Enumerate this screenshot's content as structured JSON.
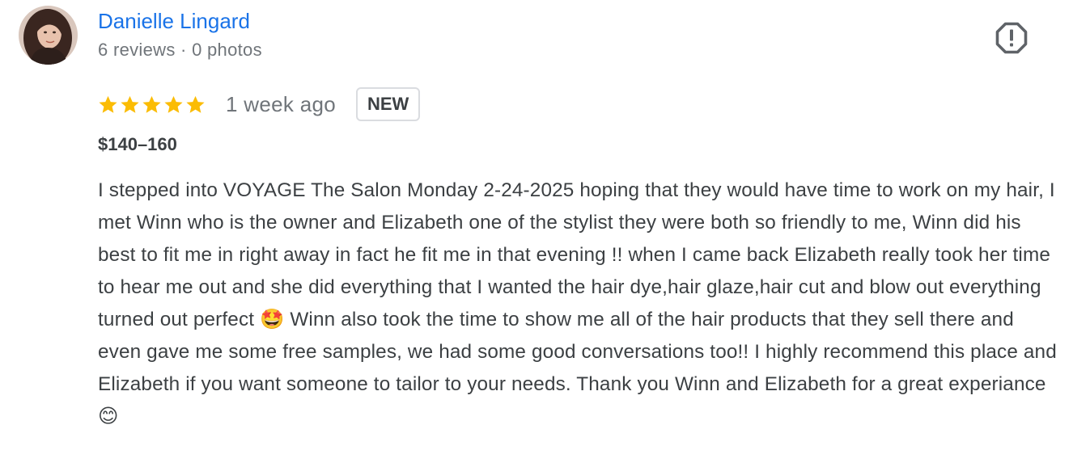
{
  "reviewer": {
    "name": "Danielle Lingard",
    "meta": "6 reviews · 0 photos",
    "avatar_icon": "reviewer-avatar-photo"
  },
  "report_icon": "report-flag-icon",
  "review": {
    "rating": 5,
    "rating_max": 5,
    "star_color": "#fbbc04",
    "time_ago": "1 week ago",
    "badge": "NEW",
    "price": "$140–160",
    "text": "I stepped into VOYAGE The Salon Monday 2-24-2025 hoping that they would have time to work on my hair, I met Winn who is the owner and Elizabeth one of the stylist they were both so friendly to me, Winn did his best to fit me in right away in fact he fit me in that evening !! when I came back Elizabeth really took her time to hear me out and she did everything that I wanted the hair dye,hair glaze,hair cut and blow out everything turned out perfect 🤩 Winn also took the time to show me all of the hair products that they sell there and even gave me some free samples, we had some good conversations too!! I highly recommend this place and Elizabeth if you want someone to tailor to your needs. Thank you Winn and Elizabeth for a great experiance😊"
  },
  "colors": {
    "link_blue": "#1a73e8",
    "muted_text": "#70757a",
    "body_text": "#3c4043"
  }
}
